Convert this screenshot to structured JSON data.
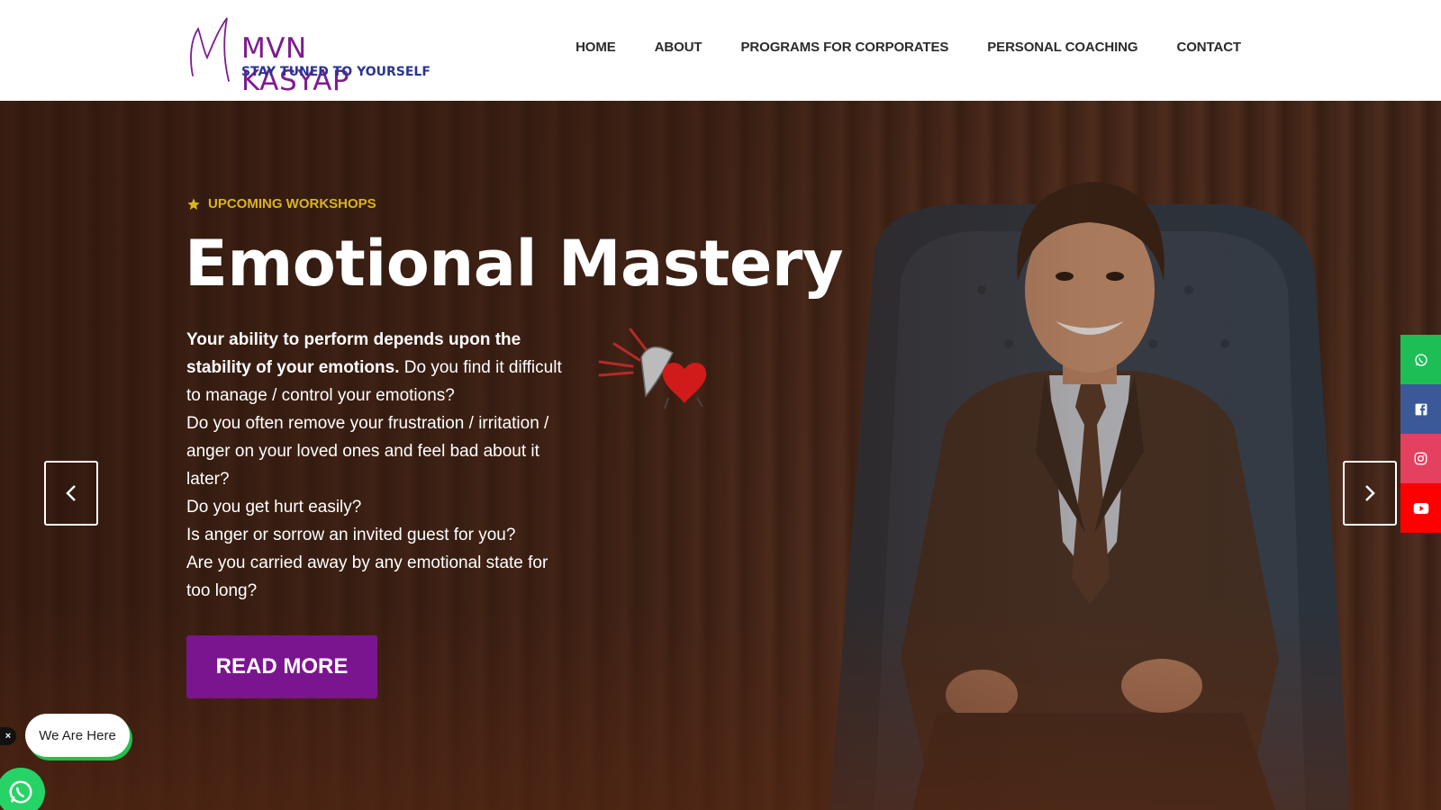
{
  "brand": {
    "name": "MVN KASYAP",
    "tagline": "STAY TUNED TO YOURSELF"
  },
  "nav": {
    "items": [
      {
        "label": "HOME"
      },
      {
        "label": "ABOUT"
      },
      {
        "label": "PROGRAMS FOR CORPORATES"
      },
      {
        "label": "PERSONAL COACHING"
      },
      {
        "label": "CONTACT"
      }
    ]
  },
  "hero": {
    "eyebrow": "UPCOMING WORKSHOPS",
    "title": "Emotional Mastery",
    "intro_bold": "Your ability to perform depends upon the stability of your emotions.",
    "intro_rest": " Do you find it difficult to manage / control your emotions?",
    "questions": [
      "Do you often remove your frustration / irritation / anger on your loved ones and feel bad about it later?",
      "Do you get hurt easily?",
      "Is anger or sorrow an invited guest for you?",
      "Are you carried away by any emotional state for too long?"
    ],
    "cta_label": "READ MORE"
  },
  "social": [
    {
      "icon": "whatsapp-icon",
      "color": "#1ebe57"
    },
    {
      "icon": "facebook-icon",
      "color": "#3b5998"
    },
    {
      "icon": "instagram-icon",
      "color": "#e4405f"
    },
    {
      "icon": "youtube-icon",
      "color": "#ff0000"
    }
  ],
  "chat": {
    "close_label": "×",
    "bubble_text": "We Are Here"
  },
  "colors": {
    "brand_purple": "#7a1590",
    "eyebrow_gold": "#d8b422",
    "whatsapp_green": "#25d366"
  }
}
